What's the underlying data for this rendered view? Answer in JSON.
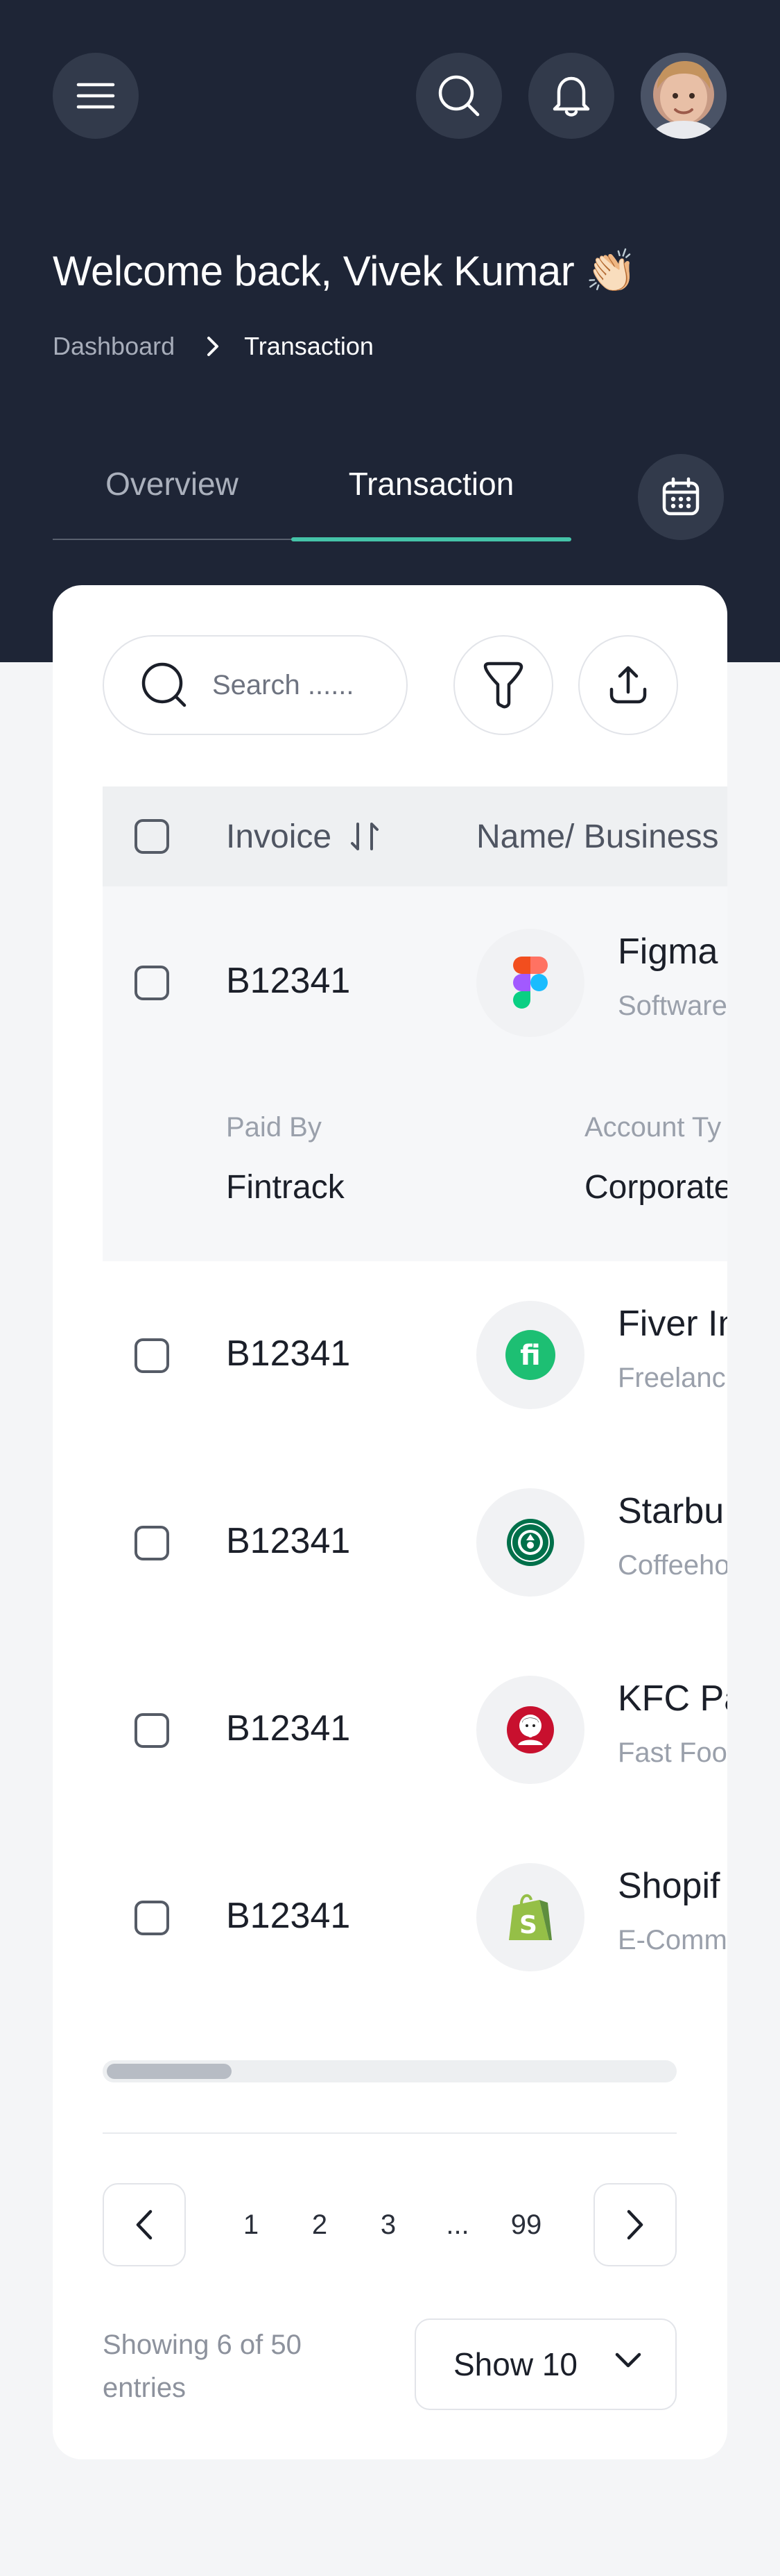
{
  "header": {
    "welcome": "Welcome back, Vivek Kumar 👏🏻",
    "breadcrumb": {
      "home": "Dashboard",
      "current": "Transaction"
    },
    "icons": {
      "menu": "menu-icon",
      "search": "search-icon",
      "notifications": "bell-icon",
      "calendar": "calendar-icon"
    }
  },
  "tabs": [
    {
      "label": "Overview",
      "active": false
    },
    {
      "label": "Transaction",
      "active": true
    }
  ],
  "colors": {
    "header_bg": "#1e2536",
    "accent": "#45c3a8",
    "page_bg": "#f4f5f7"
  },
  "toolbar": {
    "search_placeholder": "Search ......"
  },
  "table": {
    "columns": [
      "Invoice",
      "Name/ Business"
    ],
    "rows": [
      {
        "invoice": "B12341",
        "name": "Figma",
        "category": "Software",
        "logo": "figma-logo",
        "expanded": true,
        "details": {
          "paid_by_label": "Paid By",
          "paid_by": "Fintrack",
          "account_type_label": "Account Ty",
          "account_type": "Corporate"
        }
      },
      {
        "invoice": "B12341",
        "name": "Fiver In",
        "category": "Freelanc",
        "logo": "fiverr-logo"
      },
      {
        "invoice": "B12341",
        "name": "Starbu",
        "category": "Coffeehou",
        "logo": "starbucks-logo"
      },
      {
        "invoice": "B12341",
        "name": "KFC Pa",
        "category": "Fast Foo",
        "logo": "kfc-logo"
      },
      {
        "invoice": "B12341",
        "name": "Shopif",
        "category": "E-Comm",
        "logo": "shopify-logo"
      }
    ]
  },
  "pagination": {
    "pages": [
      "1",
      "2",
      "3",
      "...",
      "99"
    ],
    "current": "1",
    "showing": "Showing 6 of 50 entries",
    "page_size": "Show 10"
  }
}
